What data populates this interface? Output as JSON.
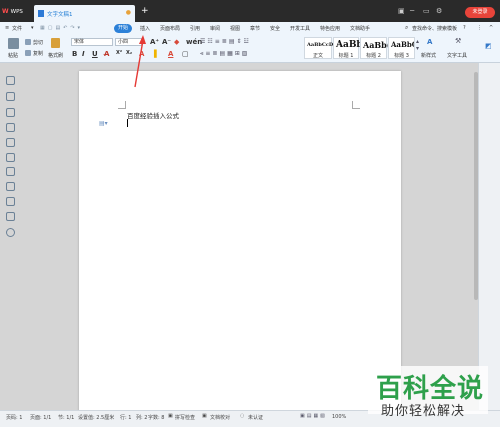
{
  "titlebar": {
    "app_tab": "WPS",
    "doc_tab": "文字文稿1",
    "new_tab": "+",
    "login": "未登录"
  },
  "menubar": {
    "file": "文件",
    "items": [
      "开始",
      "插入",
      "页面布局",
      "引用",
      "审阅",
      "视图",
      "章节",
      "安全",
      "开发工具",
      "特色应用",
      "文档助手"
    ],
    "search": "查找命令、搜索模板",
    "help": "?"
  },
  "toolbar": {
    "paste": "粘贴",
    "cut": "剪切",
    "copy": "复制",
    "format_painter": "格式刷",
    "font_name": "宋体",
    "font_size": "小四",
    "bold": "B",
    "italic": "I",
    "underline": "U",
    "styles": [
      {
        "sample": "AaBbCcDd",
        "name": "正文"
      },
      {
        "sample": "AaBb",
        "name": "标题 1"
      },
      {
        "sample": "AaBb(",
        "name": "标题 2"
      },
      {
        "sample": "AaBbC(",
        "name": "标题 3"
      }
    ],
    "new_style": "新样式",
    "text_tools": "文字工具"
  },
  "document": {
    "text": "百度经验插入公式"
  },
  "statusbar": {
    "page_num": "页码: 1",
    "pages": "页面: 1/1",
    "section": "节: 1/1",
    "setting": "设置值: 2.5厘米",
    "row": "行: 1",
    "col": "列: 2",
    "words": "字数: 8",
    "spell_check": "拼写检查",
    "doc_proof": "文档校对",
    "unverified": "未认证",
    "zoom": "100%"
  },
  "watermark": {
    "title": "百科全说",
    "subtitle": "助你轻松解决"
  },
  "colors": {
    "title_bar": "#2a2a2a",
    "ribbon": "#eef5fc",
    "accent": "#2b80d8",
    "login": "#e8443a",
    "annotation_arrow": "#e53935",
    "watermark_green": "#2ea04b"
  }
}
